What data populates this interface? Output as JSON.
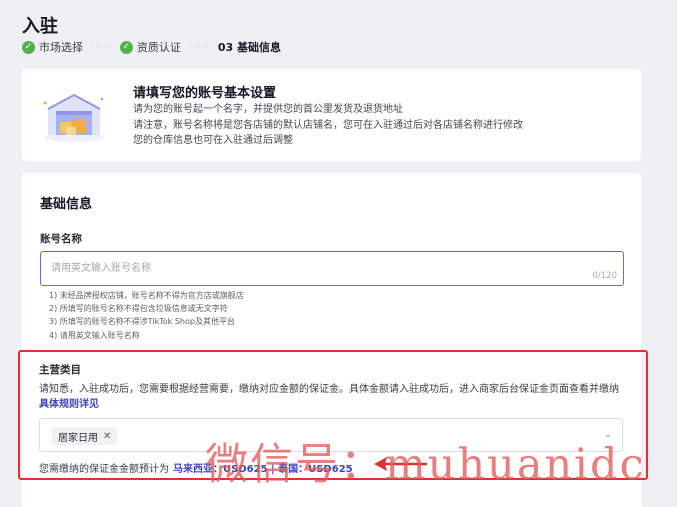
{
  "page": {
    "title": "入驻"
  },
  "steps": [
    {
      "label": "市场选择",
      "state": "done"
    },
    {
      "label": "资质认证",
      "state": "done"
    },
    {
      "label": "03 基础信息",
      "state": "current"
    }
  ],
  "intro": {
    "title": "请填写您的账号基本设置",
    "lines": [
      "请为您的账号起一个名字，并提供您的首公里发货及退货地址",
      "请注意，账号名称将是您各店铺的默认店铺名，您可在入驻通过后对各店铺名称进行修改",
      "您的仓库信息也可在入驻通过后调整"
    ]
  },
  "basic": {
    "title": "基础信息",
    "account_name": {
      "label": "账号名称",
      "placeholder": "请用英文输入账号名称",
      "value": "",
      "counter": "0/120",
      "rules": [
        "1) 未经品牌授权店铺，账号名称不得为官方店或旗舰店",
        "2) 所填写的账号名称不得包含垃圾信息或无文字符",
        "3) 所填写的账号名称不得涉TikTok Shop及其他平台",
        "4) 请用英文输入账号名称"
      ]
    },
    "category": {
      "label": "主营类目",
      "desc": "请知悉，入驻成功后，您需要根据经营需要，缴纳对应金额的保证金。具体金额请入驻成功后，进入商家后台保证金页面查看并缴纳",
      "link": "具体规则详见",
      "selected_tag": "居家日用",
      "deposit_label": "您需缴纳的保证金金额预计为",
      "deposit_value": "马来西亚：USD625 | 泰国：USD625"
    }
  },
  "watermark": "微信号：muhuanidc",
  "colors": {
    "accent": "#6f63d9",
    "link": "#3d43b8",
    "success": "#52b14f",
    "highlight": "#e03131"
  }
}
